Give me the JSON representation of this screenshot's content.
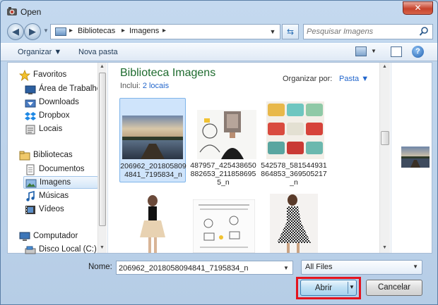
{
  "window": {
    "title": "Open",
    "close_label": "✕"
  },
  "address": {
    "crumbs": [
      "Bibliotecas",
      "Imagens"
    ],
    "search_placeholder": "Pesquisar Imagens"
  },
  "toolbar": {
    "organize_label": "Organizar",
    "new_folder_label": "Nova pasta",
    "help_label": "?"
  },
  "nav": {
    "favorites_label": "Favoritos",
    "favorites": [
      {
        "label": "Área de Trabalho",
        "icon": "desktop-icon"
      },
      {
        "label": "Downloads",
        "icon": "downloads-icon"
      },
      {
        "label": "Dropbox",
        "icon": "dropbox-icon"
      },
      {
        "label": "Locais",
        "icon": "recent-places-icon"
      }
    ],
    "libraries_label": "Bibliotecas",
    "libraries": [
      {
        "label": "Documentos",
        "icon": "documents-icon"
      },
      {
        "label": "Imagens",
        "icon": "pictures-icon",
        "selected": true
      },
      {
        "label": "Músicas",
        "icon": "music-icon"
      },
      {
        "label": "Vídeos",
        "icon": "videos-icon"
      }
    ],
    "computer_label": "Computador",
    "computer": [
      {
        "label": "Disco Local (C:)",
        "icon": "local-disk-icon"
      }
    ]
  },
  "library": {
    "title": "Biblioteca Imagens",
    "includes_label": "Inclui:",
    "includes_link": "2 locais",
    "arrange_label": "Organizar por:",
    "arrange_value": "Pasta"
  },
  "files": [
    {
      "caption": "206962_2018058094841_7195834_n",
      "kind": "lake-photo",
      "selected": true
    },
    {
      "caption": "487957_425438650882653_2118586955_n",
      "kind": "portrait-drawing"
    },
    {
      "caption": "542578_581544931864853_369505217_n",
      "kind": "typewriters"
    },
    {
      "caption": "",
      "kind": "woman-dress"
    },
    {
      "caption": "",
      "kind": "sketch-notes"
    },
    {
      "caption": "",
      "kind": "woman-dress-patterned"
    }
  ],
  "footer": {
    "filename_label": "Nome:",
    "filename_value": "206962_2018058094841_7195834_n",
    "filetype_value": "All Files",
    "open_label": "Abrir",
    "cancel_label": "Cancelar"
  },
  "colors": {
    "library_title": "#1e6b2e",
    "link": "#2266cc",
    "highlight": "#e3131e",
    "selection": "#cfe4fb"
  }
}
